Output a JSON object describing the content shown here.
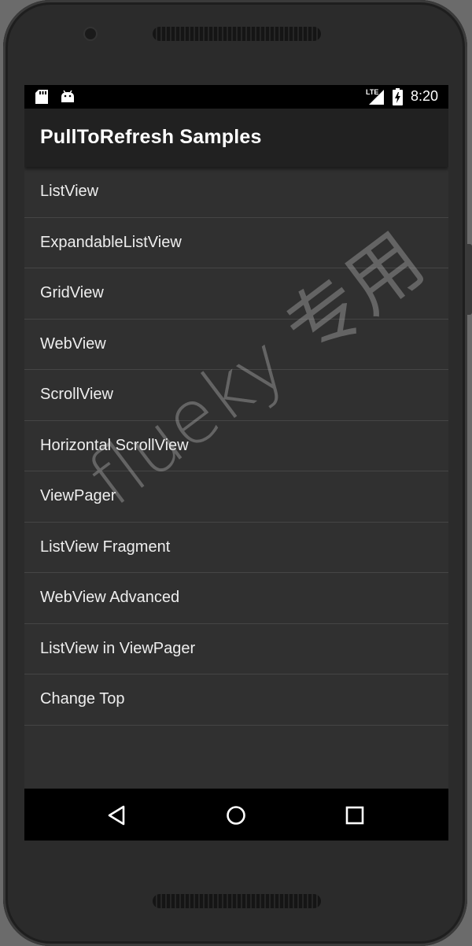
{
  "status_bar": {
    "time": "8:20",
    "network_label": "LTE",
    "icons": [
      "sd-card-icon",
      "android-icon",
      "lte-signal-icon",
      "battery-charging-icon"
    ]
  },
  "app_bar": {
    "title": "PullToRefresh Samples"
  },
  "list": {
    "items": [
      {
        "label": "ListView"
      },
      {
        "label": "ExpandableListView"
      },
      {
        "label": "GridView"
      },
      {
        "label": "WebView"
      },
      {
        "label": "ScrollView"
      },
      {
        "label": "Horizontal ScrollView"
      },
      {
        "label": "ViewPager"
      },
      {
        "label": "ListView Fragment"
      },
      {
        "label": "WebView Advanced"
      },
      {
        "label": "ListView in ViewPager"
      },
      {
        "label": "Change Top"
      }
    ]
  },
  "nav_bar": {
    "icons": [
      "back-icon",
      "home-icon",
      "recents-icon"
    ]
  },
  "watermark": {
    "text": "flueky 专用"
  },
  "colors": {
    "background": "#303030",
    "app_bar": "#212121",
    "divider": "#454545",
    "text": "#eeeeee"
  }
}
